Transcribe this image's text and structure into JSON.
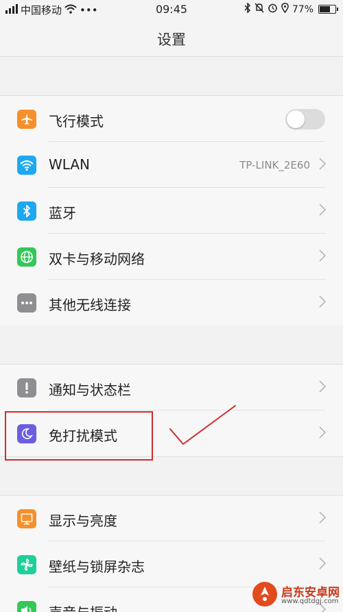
{
  "status_bar": {
    "carrier": "中国移动",
    "more": "•••",
    "time": "09:45",
    "battery": "77%",
    "battery_level": 0.77
  },
  "header": {
    "title": "设置"
  },
  "groups": [
    {
      "items": [
        {
          "label": "飞行模式",
          "icon": "airplane-icon",
          "color": "#f5902c",
          "toggle_on": false
        },
        {
          "label": "WLAN",
          "icon": "wifi-icon",
          "color": "#1ea8f0",
          "value": "TP-LINK_2E60"
        },
        {
          "label": "蓝牙",
          "icon": "bluetooth-icon",
          "color": "#1ea8f0"
        },
        {
          "label": "双卡与移动网络",
          "icon": "globe-icon",
          "color": "#34c759"
        },
        {
          "label": "其他无线连接",
          "icon": "more-icon",
          "color": "#8e8e93"
        }
      ]
    },
    {
      "items": [
        {
          "label": "通知与状态栏",
          "icon": "exclamation-icon",
          "color": "#8e8e93"
        },
        {
          "label": "免打扰模式",
          "icon": "moon-icon",
          "color": "#6b5fe0"
        }
      ]
    },
    {
      "items": [
        {
          "label": "显示与亮度",
          "icon": "monitor-icon",
          "color": "#f5902c"
        },
        {
          "label": "壁纸与锁屏杂志",
          "icon": "pinwheel-icon",
          "color": "#1fcf9a"
        },
        {
          "label": "声音与振动",
          "icon": "speaker-icon",
          "color": "#34c759"
        }
      ]
    }
  ],
  "annotation": {
    "highlight_color": "#d22b2b"
  },
  "watermark": {
    "brand": "启东安卓网",
    "url": "www.qdtdgj.com"
  }
}
